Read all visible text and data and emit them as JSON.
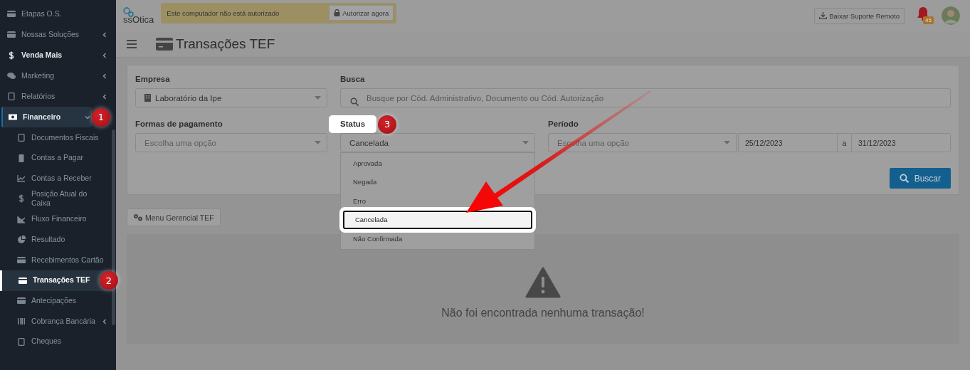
{
  "sidebar": {
    "items": [
      {
        "label": "Etapas O.S.",
        "bold": false,
        "has_submenu": false,
        "selected": false
      },
      {
        "label": "Nossas Soluções",
        "bold": false,
        "has_submenu": true,
        "expanded": false,
        "selected": false
      },
      {
        "label": "Venda Mais",
        "bold": true,
        "has_submenu": true,
        "expanded": false,
        "selected": false
      },
      {
        "label": "Marketing",
        "bold": false,
        "has_submenu": true,
        "expanded": false,
        "selected": false
      },
      {
        "label": "Relatórios",
        "bold": false,
        "has_submenu": true,
        "expanded": false,
        "selected": false
      },
      {
        "label": "Financeiro",
        "bold": true,
        "has_submenu": true,
        "expanded": true,
        "selected": true,
        "callout": "1",
        "children": [
          {
            "label": "Documentos Fiscais",
            "has_submenu": false,
            "selected": false
          },
          {
            "label": "Contas a Pagar",
            "has_submenu": false,
            "selected": false
          },
          {
            "label": "Contas a Receber",
            "has_submenu": false,
            "selected": false
          },
          {
            "label": "Posição Atual do Caixa",
            "has_submenu": false,
            "selected": false
          },
          {
            "label": "Fluxo Financeiro",
            "has_submenu": false,
            "selected": false
          },
          {
            "label": "Resultado",
            "has_submenu": false,
            "selected": false
          },
          {
            "label": "Recebimentos Cartão",
            "has_submenu": false,
            "selected": false
          },
          {
            "label": "Transações TEF",
            "has_submenu": false,
            "selected": true,
            "callout": "2"
          },
          {
            "label": "Antecipações",
            "has_submenu": false,
            "selected": false
          },
          {
            "label": "Cobrança Bancária",
            "has_submenu": true,
            "selected": false
          },
          {
            "label": "Cheques",
            "has_submenu": false,
            "selected": false
          }
        ]
      }
    ]
  },
  "header": {
    "logo": "ssOtica",
    "alert": "Este computador não está autorizado",
    "alert_button": "Autorizar agora",
    "support_button": "Baixar Suporte Remoto",
    "notifications": "45"
  },
  "page": {
    "title": "Transações TEF"
  },
  "filters": {
    "empresa": {
      "label": "Empresa",
      "value": "Laboratório da Ipe"
    },
    "busca": {
      "label": "Busca",
      "placeholder": "Busque por Cód. Administrativo, Documento ou Cód. Autorização"
    },
    "formas": {
      "label": "Formas de pagamento",
      "placeholder": "Escolha uma opção"
    },
    "status": {
      "label": "Status",
      "highlighted": true,
      "callout": "3",
      "value": "Cancelada",
      "expanded": true,
      "options": [
        {
          "label": "Aprovada",
          "selected": false
        },
        {
          "label": "Negada",
          "selected": false
        },
        {
          "label": "Erro",
          "selected": false
        },
        {
          "label": "Cancelada",
          "selected": true
        },
        {
          "label": "Não Confirmada",
          "selected": false
        }
      ]
    },
    "periodo": {
      "label": "Período",
      "placeholder": "Escolha uma opção",
      "from": "25/12/2023",
      "separator": "a",
      "to": "31/12/2023"
    },
    "search_button": "Buscar"
  },
  "menu_button": "Menu Gerencial TEF",
  "empty_state": {
    "message": "Não foi encontrada nenhuma transação!"
  }
}
